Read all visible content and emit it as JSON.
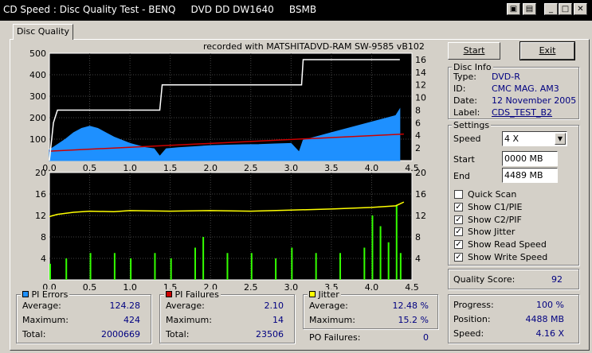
{
  "window": {
    "title": "CD Speed : Disc Quality Test - BENQ     DVD DD DW1640     BSMB"
  },
  "tabs": [
    {
      "label": "Disc Quality"
    }
  ],
  "chart_header": "recorded with MATSHITADVD-RAM SW-9585  vB102",
  "buttons": {
    "start": "Start",
    "exit": "Exit"
  },
  "disc_info": {
    "heading": "Disc Info",
    "type_label": "Type:",
    "type": "DVD-R",
    "id_label": "ID:",
    "id": "CMC MAG. AM3",
    "date_label": "Date:",
    "date": "12 November 2005",
    "label_label": "Label:",
    "label": "CDS_TEST_B2"
  },
  "settings": {
    "heading": "Settings",
    "speed_label": "Speed",
    "speed": "4 X",
    "start_label": "Start",
    "start": "0000 MB",
    "end_label": "End",
    "end": "4489 MB",
    "options": [
      {
        "label": "Quick Scan",
        "checked": false
      },
      {
        "label": "Show C1/PIE",
        "checked": true
      },
      {
        "label": "Show C2/PIF",
        "checked": true
      },
      {
        "label": "Show Jitter",
        "checked": true
      },
      {
        "label": "Show Read Speed",
        "checked": true
      },
      {
        "label": "Show Write Speed",
        "checked": true
      }
    ]
  },
  "quality": {
    "label": "Quality Score:",
    "value": "92"
  },
  "progress": {
    "progress_label": "Progress:",
    "progress": "100 %",
    "position_label": "Position:",
    "position": "4488 MB",
    "speed_label": "Speed:",
    "speed": "4.16 X"
  },
  "pi_errors": {
    "heading": "PI Errors",
    "color": "#1e90ff",
    "average_label": "Average:",
    "average": "124.28",
    "maximum_label": "Maximum:",
    "maximum": "424",
    "total_label": "Total:",
    "total": "2000669"
  },
  "pi_failures": {
    "heading": "PI Failures",
    "color": "#cc0000",
    "average_label": "Average:",
    "average": "2.10",
    "maximum_label": "Maximum:",
    "maximum": "14",
    "total_label": "Total:",
    "total": "23506"
  },
  "jitter": {
    "heading": "Jitter",
    "color": "#ffff00",
    "average_label": "Average:",
    "average": "12.48 %",
    "maximum_label": "Maximum:",
    "maximum": "15.2 %"
  },
  "po_failures": {
    "label": "PO Failures:",
    "value": "0"
  },
  "chart_data": [
    {
      "type": "area",
      "xlim": [
        0,
        4.5
      ],
      "x_ticks": [
        "0.0",
        "0.5",
        "1.0",
        "1.5",
        "2.0",
        "2.5",
        "3.0",
        "3.5",
        "4.0",
        "4.5"
      ],
      "ylim": [
        0,
        500
      ],
      "y_ticks_left": [
        "500",
        "400",
        "300",
        "200",
        "100"
      ],
      "y2lim": [
        0,
        17
      ],
      "y_ticks_right": [
        "16",
        "14",
        "12",
        "10",
        "8",
        "6",
        "4",
        "2"
      ],
      "grid": true,
      "series": [
        {
          "role": "pi_errors",
          "color": "#1e90ff",
          "x": [
            0.0,
            0.1,
            0.2,
            0.3,
            0.4,
            0.5,
            0.6,
            0.7,
            0.8,
            0.9,
            1.0,
            1.1,
            1.2,
            1.3,
            1.37,
            1.45,
            1.6,
            1.8,
            2.0,
            2.2,
            2.4,
            2.6,
            2.8,
            3.0,
            3.1,
            3.15,
            3.3,
            3.5,
            3.7,
            3.9,
            4.1,
            4.3,
            4.35
          ],
          "values": [
            50,
            75,
            100,
            130,
            150,
            160,
            150,
            130,
            110,
            95,
            80,
            70,
            60,
            55,
            20,
            55,
            60,
            65,
            70,
            72,
            74,
            75,
            78,
            80,
            40,
            95,
            110,
            130,
            150,
            170,
            190,
            210,
            240
          ]
        },
        {
          "role": "read_speed",
          "color": "#cc0000",
          "x": [
            0.0,
            4.4
          ],
          "values": [
            1.5,
            4.2
          ]
        },
        {
          "role": "write_speed",
          "color": "#ffffff",
          "x": [
            0.0,
            0.05,
            0.1,
            1.37,
            1.4,
            3.13,
            3.15,
            4.35
          ],
          "values": [
            0,
            6,
            8,
            8,
            12,
            12,
            16,
            16
          ]
        }
      ]
    },
    {
      "type": "bar",
      "xlim": [
        0,
        4.5
      ],
      "x_ticks": [
        "0.0",
        "0.5",
        "1.0",
        "1.5",
        "2.0",
        "2.5",
        "3.0",
        "3.5",
        "4.0",
        "4.5"
      ],
      "ylim": [
        0,
        20
      ],
      "y_ticks_left": [
        "20",
        "16",
        "12",
        "8",
        "4"
      ],
      "y_ticks_right": [
        "20",
        "16",
        "12",
        "8",
        "4"
      ],
      "grid": true,
      "series": [
        {
          "role": "jitter",
          "color": "#ffff00",
          "x": [
            0.0,
            0.1,
            0.3,
            0.5,
            0.8,
            1.0,
            1.5,
            2.0,
            2.5,
            3.0,
            3.5,
            4.0,
            4.3,
            4.4
          ],
          "values": [
            11.8,
            12.2,
            12.6,
            12.8,
            12.7,
            12.9,
            12.8,
            12.9,
            12.8,
            13.0,
            13.2,
            13.5,
            13.8,
            14.5
          ]
        },
        {
          "role": "pi_failures",
          "color": "#33ff00",
          "x": [
            0.0,
            0.2,
            0.5,
            0.8,
            1.0,
            1.3,
            1.37,
            1.5,
            1.8,
            1.9,
            2.2,
            2.5,
            2.8,
            3.0,
            3.13,
            3.3,
            3.6,
            3.9,
            4.0,
            4.1,
            4.2,
            4.3,
            4.35
          ],
          "values": [
            3,
            4,
            5,
            5,
            4,
            5,
            0,
            4,
            6,
            8,
            5,
            5,
            4,
            6,
            0,
            5,
            5,
            6,
            12,
            10,
            7,
            14,
            5
          ]
        }
      ]
    }
  ]
}
